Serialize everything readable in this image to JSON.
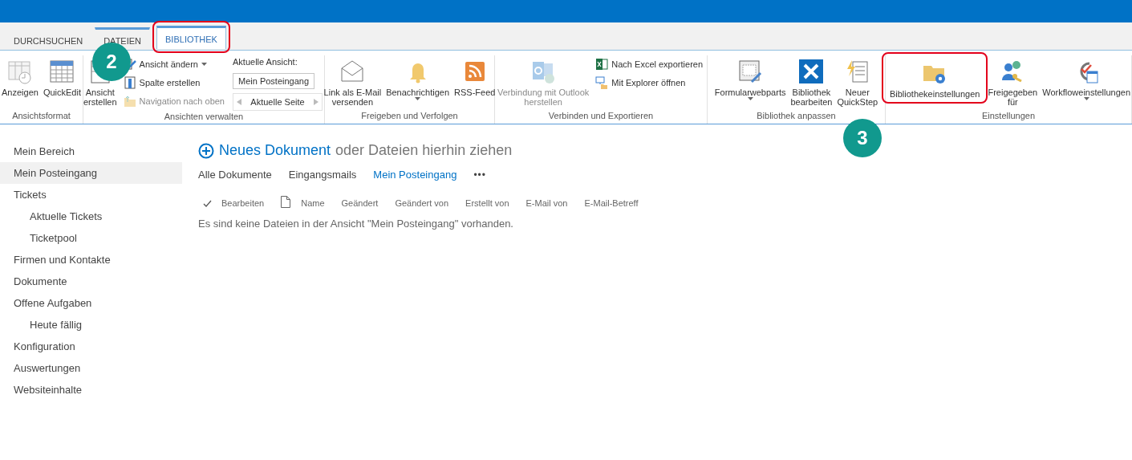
{
  "tabs": [
    {
      "label": "DURCHSUCHEN",
      "selected": false,
      "contextual": false,
      "highlighted": false
    },
    {
      "label": "DATEIEN",
      "selected": false,
      "contextual": true,
      "highlighted": false
    },
    {
      "label": "BIBLIOTHEK",
      "selected": true,
      "contextual": true,
      "highlighted": true
    }
  ],
  "ribbon_groups": [
    {
      "label": "Ansichtsformat",
      "items": [
        {
          "kind": "large",
          "label": "Anzeigen",
          "disabled": false,
          "menu": false,
          "highlighted": false
        },
        {
          "kind": "large",
          "label": "QuickEdit",
          "disabled": false,
          "menu": false,
          "highlighted": false
        }
      ]
    },
    {
      "label": "Ansichten verwalten",
      "items": [
        {
          "kind": "large",
          "label": "Ansicht\nerstellen",
          "disabled": false,
          "menu": false,
          "highlighted": false
        },
        {
          "kind": "stack",
          "items": [
            {
              "kind": "small",
              "label": "Ansicht ändern",
              "disabled": false,
              "menu": true
            },
            {
              "kind": "small",
              "label": "Spalte erstellen",
              "disabled": false,
              "menu": false
            },
            {
              "kind": "small",
              "label": "Navigation nach oben",
              "disabled": true,
              "menu": false
            }
          ]
        },
        {
          "kind": "stack",
          "items": [
            {
              "kind": "label",
              "label": "Aktuelle Ansicht:"
            },
            {
              "kind": "select",
              "value": "Mein Posteingang"
            },
            {
              "kind": "pager",
              "label": "Aktuelle Seite"
            }
          ]
        }
      ]
    },
    {
      "label": "Freigeben und Verfolgen",
      "items": [
        {
          "kind": "large",
          "label": "Link als E-Mail\nversenden",
          "disabled": false,
          "menu": false,
          "highlighted": false
        },
        {
          "kind": "large",
          "label": "Benachrichtigen",
          "disabled": false,
          "menu": true,
          "highlighted": false
        },
        {
          "kind": "large",
          "label": "RSS-Feed",
          "disabled": false,
          "menu": false,
          "highlighted": false
        }
      ]
    },
    {
      "label": "Verbinden und Exportieren",
      "items": [
        {
          "kind": "large",
          "label": "Verbindung mit Outlook\nherstellen",
          "disabled": true,
          "menu": false,
          "highlighted": false
        },
        {
          "kind": "stack",
          "items": [
            {
              "kind": "small",
              "label": "Nach Excel exportieren",
              "disabled": false,
              "menu": false
            },
            {
              "kind": "small",
              "label": "Mit Explorer öffnen",
              "disabled": false,
              "menu": false
            }
          ]
        }
      ]
    },
    {
      "label": "Bibliothek anpassen",
      "items": [
        {
          "kind": "large",
          "label": "Formularwebparts",
          "disabled": false,
          "menu": true,
          "highlighted": false
        },
        {
          "kind": "large",
          "label": "Bibliothek\nbearbeiten",
          "disabled": false,
          "menu": false,
          "highlighted": false
        },
        {
          "kind": "large",
          "label": "Neuer\nQuickStep",
          "disabled": false,
          "menu": false,
          "highlighted": false
        }
      ]
    },
    {
      "label": "Einstellungen",
      "items": [
        {
          "kind": "large",
          "label": "Bibliothekeinstellungen",
          "disabled": false,
          "menu": false,
          "highlighted": true
        },
        {
          "kind": "large",
          "label": "Freigegeben\nfür",
          "disabled": false,
          "menu": false,
          "highlighted": false
        },
        {
          "kind": "large",
          "label": "Workfloweinstellungen",
          "disabled": false,
          "menu": true,
          "highlighted": false
        }
      ]
    }
  ],
  "nav": [
    {
      "label": "Mein Bereich",
      "selected": false
    },
    {
      "label": "Mein Posteingang",
      "selected": true
    },
    {
      "label": "Tickets",
      "selected": false,
      "children": [
        {
          "label": "Aktuelle Tickets",
          "selected": false
        },
        {
          "label": "Ticketpool",
          "selected": false
        }
      ]
    },
    {
      "label": "Firmen und Kontakte",
      "selected": false
    },
    {
      "label": "Dokumente",
      "selected": false
    },
    {
      "label": "Offene Aufgaben",
      "selected": false,
      "children": [
        {
          "label": "Heute fällig",
          "selected": false
        }
      ]
    },
    {
      "label": "Konfiguration",
      "selected": false
    },
    {
      "label": "Auswertungen",
      "selected": false
    },
    {
      "label": "Websiteinhalte",
      "selected": false
    }
  ],
  "heading": {
    "link": "Neues Dokument",
    "text": "oder Dateien hierhin ziehen"
  },
  "views": [
    {
      "label": "Alle Dokumente",
      "selected": false
    },
    {
      "label": "Eingangsmails",
      "selected": false
    },
    {
      "label": "Mein Posteingang",
      "selected": true
    }
  ],
  "views_more": "•••",
  "columns": [
    "Bearbeiten",
    "Name",
    "Geändert",
    "Geändert von",
    "Erstellt von",
    "E-Mail von",
    "E-Mail-Betreff"
  ],
  "empty_message": "Es sind keine Dateien in der Ansicht \"Mein Posteingang\" vorhanden.",
  "step_badges": [
    "2",
    "3"
  ]
}
